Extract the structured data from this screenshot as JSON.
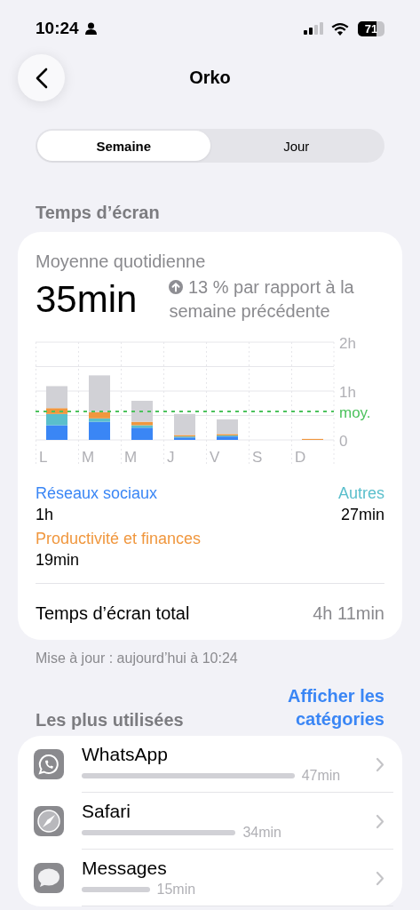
{
  "status_bar": {
    "time": "10:24",
    "battery": "71"
  },
  "nav": {
    "title": "Orko"
  },
  "tabs": [
    {
      "label": "Semaine",
      "selected": true
    },
    {
      "label": "Jour",
      "selected": false
    }
  ],
  "screen_time": {
    "header": "Temps d’écran",
    "daily_average_label": "Moyenne quotidienne",
    "daily_average": "35min",
    "trend": "13 % par rapport à la semaine précédente",
    "chart_data": {
      "type": "bar",
      "stacked": true,
      "categories": [
        "L",
        "M",
        "M",
        "J",
        "V",
        "S",
        "D"
      ],
      "series": [
        {
          "name": "Réseaux sociaux",
          "color": "#3a86f5",
          "values": [
            0.3,
            0.37,
            0.25,
            0.05,
            0.07,
            0,
            0
          ]
        },
        {
          "name": "Autres",
          "color": "#5abfcc",
          "values": [
            0.23,
            0.07,
            0.05,
            0.02,
            0.02,
            0,
            0
          ]
        },
        {
          "name": "Productivité et finances",
          "color": "#f0973e",
          "values": [
            0.12,
            0.13,
            0.07,
            0.03,
            0.03,
            0,
            0.02
          ]
        },
        {
          "color": "#d1d1d6",
          "values": [
            0.45,
            0.75,
            0.43,
            0.43,
            0.3,
            0,
            0
          ]
        }
      ],
      "ylim": [
        0,
        2
      ],
      "yticks": [
        {
          "value": 0,
          "label": "0"
        },
        {
          "value": 1,
          "label": "1h"
        },
        {
          "value": 2,
          "label": "2h"
        }
      ],
      "ref_lines": [
        {
          "axis": "y",
          "value": 0.5833,
          "label": "moy.",
          "color": "#4cc25d"
        }
      ]
    },
    "category_totals": [
      "1h",
      "27min",
      "19min"
    ],
    "total_label": "Temps d’écran total",
    "total_value": "4h 11min"
  },
  "updated": "Mise à jour : aujourd’hui à 10:24",
  "most_used": {
    "header": "Les plus utilisées",
    "link": "Afficher les catégories",
    "apps": [
      {
        "name": "WhatsApp",
        "time": "47min",
        "kind": "whatsapp"
      },
      {
        "name": "Safari",
        "time": "34min",
        "kind": "safari"
      },
      {
        "name": "Messages",
        "time": "15min",
        "kind": "messages"
      }
    ]
  }
}
